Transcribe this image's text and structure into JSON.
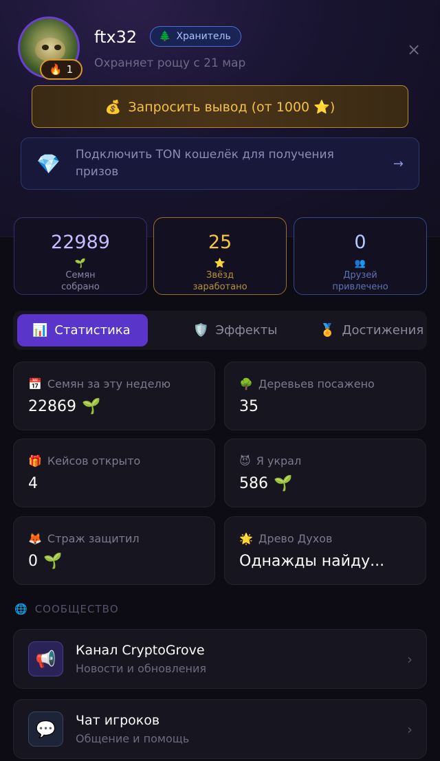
{
  "profile": {
    "username": "ftx32",
    "role_icon": "🌲",
    "role": "Хранитель",
    "subtitle": "Охраняет рощу с 21 мар",
    "streak_icon": "🔥",
    "streak": "1",
    "close": "×"
  },
  "withdraw": {
    "icon": "💰",
    "label": "Запросить вывод (от 1000 ⭐)"
  },
  "ton": {
    "icon": "💎",
    "label": "Подключить TON кошелёк для получения призов",
    "arrow": "→"
  },
  "stats": [
    {
      "value": "22989",
      "icon": "🌱",
      "label": "Семян собрано"
    },
    {
      "value": "25",
      "icon": "⭐",
      "label": "Звёзд заработано"
    },
    {
      "value": "0",
      "icon": "👥",
      "label": "Друзей привлечено"
    }
  ],
  "tabs": [
    {
      "icon": "📊",
      "label": "Статистика"
    },
    {
      "icon": "🛡️",
      "label": "Эффекты"
    },
    {
      "icon": "🏅",
      "label": "Достижения"
    }
  ],
  "cards": [
    {
      "icon": "📅",
      "label": "Семян за эту неделю",
      "value": "22869",
      "suffix": "🌱"
    },
    {
      "icon": "🌳",
      "label": "Деревьев посажено",
      "value": "35",
      "suffix": ""
    },
    {
      "icon": "🎁",
      "label": "Кейсов открыто",
      "value": "4",
      "suffix": ""
    },
    {
      "icon": "😈",
      "label": "Я украл",
      "value": "586",
      "suffix": "🌱"
    },
    {
      "icon": "🦊",
      "label": "Страж защитил",
      "value": "0",
      "suffix": "🌱"
    },
    {
      "icon": "🌟",
      "label": "Древо Духов",
      "value": "Однажды найду...",
      "suffix": ""
    }
  ],
  "community": {
    "icon": "🌐",
    "title": "СООБЩЕСТВО",
    "links": [
      {
        "icon": "📢",
        "title": "Канал CryptoGrove",
        "subtitle": "Новости и обновления",
        "chevron": "›"
      },
      {
        "icon": "💬",
        "title": "Чат игроков",
        "subtitle": "Общение и помощь",
        "chevron": "›"
      }
    ]
  }
}
